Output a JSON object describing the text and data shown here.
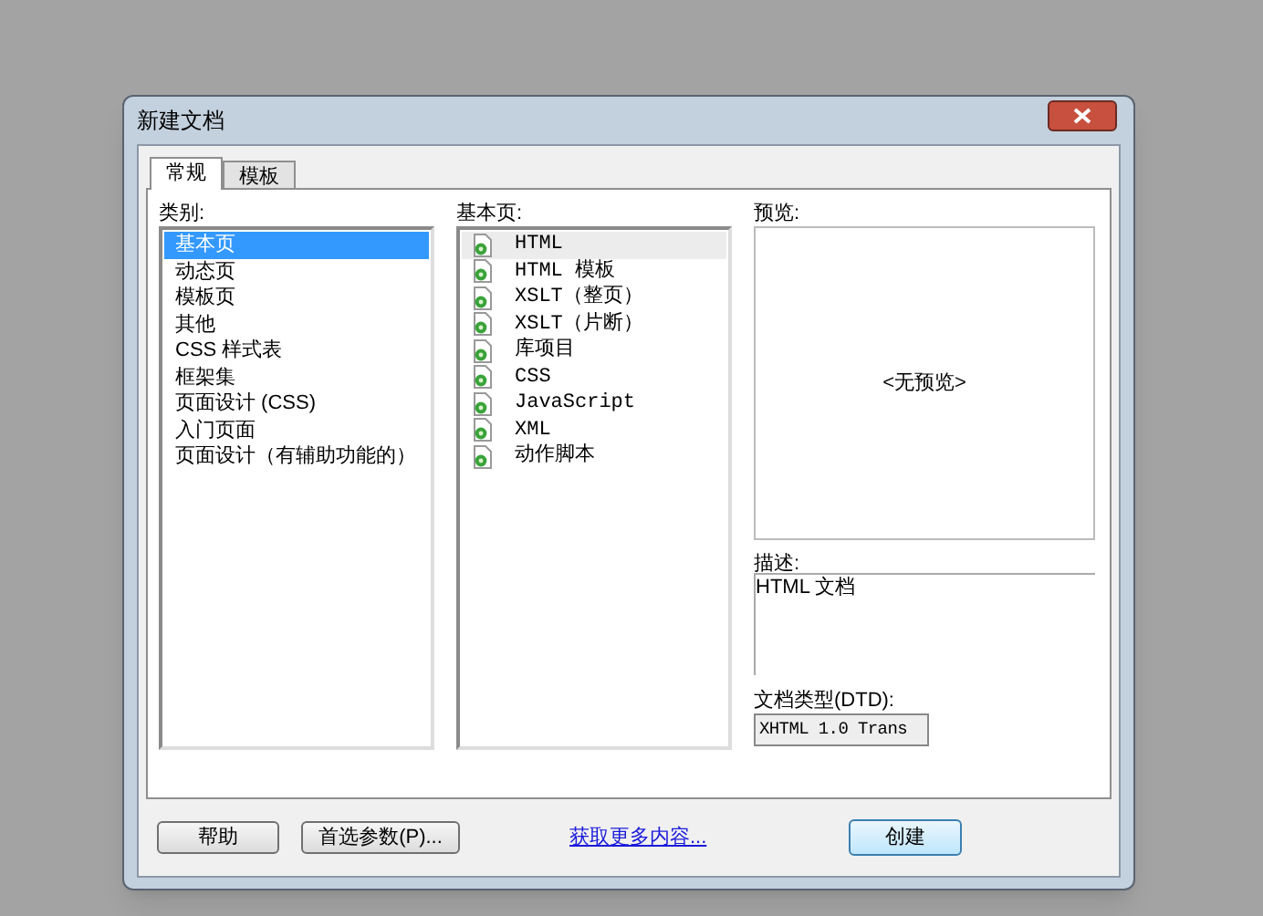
{
  "window": {
    "title": "新建文档"
  },
  "tabs": [
    {
      "label": "常规",
      "selected": true
    },
    {
      "label": "模板",
      "selected": false
    }
  ],
  "category": {
    "label": "类别:",
    "items": [
      {
        "label": "基本页",
        "selected": true
      },
      {
        "label": "动态页",
        "selected": false
      },
      {
        "label": "模板页",
        "selected": false
      },
      {
        "label": "其他",
        "selected": false
      },
      {
        "label": "CSS 样式表",
        "selected": false
      },
      {
        "label": "框架集",
        "selected": false
      },
      {
        "label": "页面设计 (CSS)",
        "selected": false
      },
      {
        "label": "入门页面",
        "selected": false
      },
      {
        "label": "页面设计（有辅助功能的）",
        "selected": false
      }
    ]
  },
  "page_list": {
    "label": "基本页:",
    "items": [
      {
        "label": "HTML",
        "selected": true
      },
      {
        "label": "HTML 模板",
        "selected": false
      },
      {
        "label": "XSLT（整页）",
        "selected": false
      },
      {
        "label": "XSLT（片断）",
        "selected": false
      },
      {
        "label": "库项目",
        "selected": false
      },
      {
        "label": "CSS",
        "selected": false
      },
      {
        "label": "JavaScript",
        "selected": false
      },
      {
        "label": "XML",
        "selected": false
      },
      {
        "label": "动作脚本",
        "selected": false
      }
    ]
  },
  "preview": {
    "label": "预览:",
    "text": "<无预览>"
  },
  "description": {
    "label": "描述:",
    "text": "HTML 文档"
  },
  "doctype": {
    "label": "文档类型(DTD):",
    "value": "XHTML 1.0 Trans"
  },
  "footer": {
    "help": "帮助",
    "preferences": "首选参数(P)...",
    "link": "获取更多内容...",
    "create": "创建"
  }
}
